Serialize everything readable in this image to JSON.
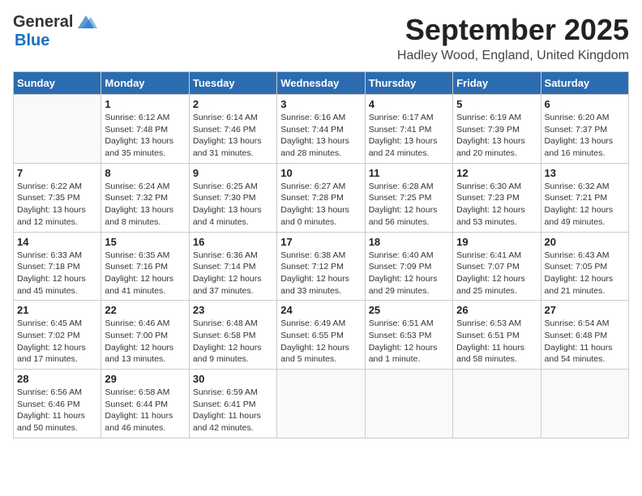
{
  "header": {
    "logo_general": "General",
    "logo_blue": "Blue",
    "month_title": "September 2025",
    "location": "Hadley Wood, England, United Kingdom"
  },
  "weekdays": [
    "Sunday",
    "Monday",
    "Tuesday",
    "Wednesday",
    "Thursday",
    "Friday",
    "Saturday"
  ],
  "weeks": [
    [
      {
        "day": "",
        "sunrise": "",
        "sunset": "",
        "daylight": ""
      },
      {
        "day": "1",
        "sunrise": "Sunrise: 6:12 AM",
        "sunset": "Sunset: 7:48 PM",
        "daylight": "Daylight: 13 hours and 35 minutes."
      },
      {
        "day": "2",
        "sunrise": "Sunrise: 6:14 AM",
        "sunset": "Sunset: 7:46 PM",
        "daylight": "Daylight: 13 hours and 31 minutes."
      },
      {
        "day": "3",
        "sunrise": "Sunrise: 6:16 AM",
        "sunset": "Sunset: 7:44 PM",
        "daylight": "Daylight: 13 hours and 28 minutes."
      },
      {
        "day": "4",
        "sunrise": "Sunrise: 6:17 AM",
        "sunset": "Sunset: 7:41 PM",
        "daylight": "Daylight: 13 hours and 24 minutes."
      },
      {
        "day": "5",
        "sunrise": "Sunrise: 6:19 AM",
        "sunset": "Sunset: 7:39 PM",
        "daylight": "Daylight: 13 hours and 20 minutes."
      },
      {
        "day": "6",
        "sunrise": "Sunrise: 6:20 AM",
        "sunset": "Sunset: 7:37 PM",
        "daylight": "Daylight: 13 hours and 16 minutes."
      }
    ],
    [
      {
        "day": "7",
        "sunrise": "Sunrise: 6:22 AM",
        "sunset": "Sunset: 7:35 PM",
        "daylight": "Daylight: 13 hours and 12 minutes."
      },
      {
        "day": "8",
        "sunrise": "Sunrise: 6:24 AM",
        "sunset": "Sunset: 7:32 PM",
        "daylight": "Daylight: 13 hours and 8 minutes."
      },
      {
        "day": "9",
        "sunrise": "Sunrise: 6:25 AM",
        "sunset": "Sunset: 7:30 PM",
        "daylight": "Daylight: 13 hours and 4 minutes."
      },
      {
        "day": "10",
        "sunrise": "Sunrise: 6:27 AM",
        "sunset": "Sunset: 7:28 PM",
        "daylight": "Daylight: 13 hours and 0 minutes."
      },
      {
        "day": "11",
        "sunrise": "Sunrise: 6:28 AM",
        "sunset": "Sunset: 7:25 PM",
        "daylight": "Daylight: 12 hours and 56 minutes."
      },
      {
        "day": "12",
        "sunrise": "Sunrise: 6:30 AM",
        "sunset": "Sunset: 7:23 PM",
        "daylight": "Daylight: 12 hours and 53 minutes."
      },
      {
        "day": "13",
        "sunrise": "Sunrise: 6:32 AM",
        "sunset": "Sunset: 7:21 PM",
        "daylight": "Daylight: 12 hours and 49 minutes."
      }
    ],
    [
      {
        "day": "14",
        "sunrise": "Sunrise: 6:33 AM",
        "sunset": "Sunset: 7:18 PM",
        "daylight": "Daylight: 12 hours and 45 minutes."
      },
      {
        "day": "15",
        "sunrise": "Sunrise: 6:35 AM",
        "sunset": "Sunset: 7:16 PM",
        "daylight": "Daylight: 12 hours and 41 minutes."
      },
      {
        "day": "16",
        "sunrise": "Sunrise: 6:36 AM",
        "sunset": "Sunset: 7:14 PM",
        "daylight": "Daylight: 12 hours and 37 minutes."
      },
      {
        "day": "17",
        "sunrise": "Sunrise: 6:38 AM",
        "sunset": "Sunset: 7:12 PM",
        "daylight": "Daylight: 12 hours and 33 minutes."
      },
      {
        "day": "18",
        "sunrise": "Sunrise: 6:40 AM",
        "sunset": "Sunset: 7:09 PM",
        "daylight": "Daylight: 12 hours and 29 minutes."
      },
      {
        "day": "19",
        "sunrise": "Sunrise: 6:41 AM",
        "sunset": "Sunset: 7:07 PM",
        "daylight": "Daylight: 12 hours and 25 minutes."
      },
      {
        "day": "20",
        "sunrise": "Sunrise: 6:43 AM",
        "sunset": "Sunset: 7:05 PM",
        "daylight": "Daylight: 12 hours and 21 minutes."
      }
    ],
    [
      {
        "day": "21",
        "sunrise": "Sunrise: 6:45 AM",
        "sunset": "Sunset: 7:02 PM",
        "daylight": "Daylight: 12 hours and 17 minutes."
      },
      {
        "day": "22",
        "sunrise": "Sunrise: 6:46 AM",
        "sunset": "Sunset: 7:00 PM",
        "daylight": "Daylight: 12 hours and 13 minutes."
      },
      {
        "day": "23",
        "sunrise": "Sunrise: 6:48 AM",
        "sunset": "Sunset: 6:58 PM",
        "daylight": "Daylight: 12 hours and 9 minutes."
      },
      {
        "day": "24",
        "sunrise": "Sunrise: 6:49 AM",
        "sunset": "Sunset: 6:55 PM",
        "daylight": "Daylight: 12 hours and 5 minutes."
      },
      {
        "day": "25",
        "sunrise": "Sunrise: 6:51 AM",
        "sunset": "Sunset: 6:53 PM",
        "daylight": "Daylight: 12 hours and 1 minute."
      },
      {
        "day": "26",
        "sunrise": "Sunrise: 6:53 AM",
        "sunset": "Sunset: 6:51 PM",
        "daylight": "Daylight: 11 hours and 58 minutes."
      },
      {
        "day": "27",
        "sunrise": "Sunrise: 6:54 AM",
        "sunset": "Sunset: 6:48 PM",
        "daylight": "Daylight: 11 hours and 54 minutes."
      }
    ],
    [
      {
        "day": "28",
        "sunrise": "Sunrise: 6:56 AM",
        "sunset": "Sunset: 6:46 PM",
        "daylight": "Daylight: 11 hours and 50 minutes."
      },
      {
        "day": "29",
        "sunrise": "Sunrise: 6:58 AM",
        "sunset": "Sunset: 6:44 PM",
        "daylight": "Daylight: 11 hours and 46 minutes."
      },
      {
        "day": "30",
        "sunrise": "Sunrise: 6:59 AM",
        "sunset": "Sunset: 6:41 PM",
        "daylight": "Daylight: 11 hours and 42 minutes."
      },
      {
        "day": "",
        "sunrise": "",
        "sunset": "",
        "daylight": ""
      },
      {
        "day": "",
        "sunrise": "",
        "sunset": "",
        "daylight": ""
      },
      {
        "day": "",
        "sunrise": "",
        "sunset": "",
        "daylight": ""
      },
      {
        "day": "",
        "sunrise": "",
        "sunset": "",
        "daylight": ""
      }
    ]
  ]
}
